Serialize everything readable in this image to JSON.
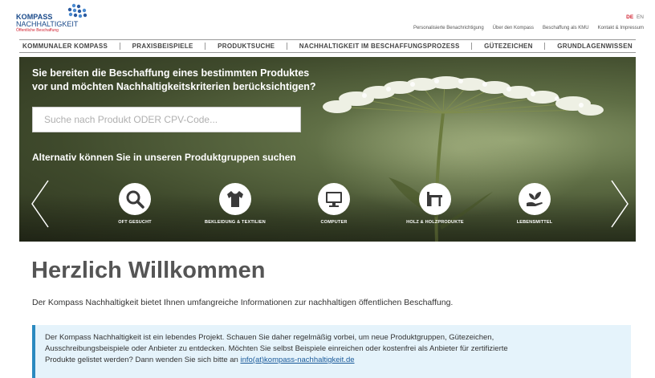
{
  "logo": {
    "line1": "KOMPASS",
    "line2": "NACHHALTIGKEIT",
    "line3": "Öffentliche Beschaffung"
  },
  "lang": {
    "de": "DE",
    "en": "EN"
  },
  "topnav": [
    "Personalisierte Benachrichtigung",
    "Über den Kompass",
    "Beschaffung als KMU",
    "Kontakt & Impressum"
  ],
  "mainnav": [
    "KOMMUNALER KOMPASS",
    "PRAXISBEISPIELE",
    "PRODUKTSUCHE",
    "NACHHALTIGKEIT IM BESCHAFFUNGSPROZESS",
    "GÜTEZEICHEN",
    "GRUNDLAGENWISSEN"
  ],
  "hero": {
    "title_line1": "Sie bereiten die Beschaffung eines bestimmten Produktes",
    "title_line2": "vor und möchten Nachhaltigkeitskriterien berücksichtigen?",
    "search_placeholder": "Suche nach Produkt ODER CPV-Code...",
    "search_value": "",
    "subtitle": "Alternativ können Sie in unseren Produktgruppen suchen",
    "categories": [
      {
        "label": "OFT GESUCHT",
        "icon": "magnifier-icon"
      },
      {
        "label": "BEKLEIDUNG & TEXTILIEN",
        "icon": "shirt-icon"
      },
      {
        "label": "COMPUTER",
        "icon": "monitor-icon"
      },
      {
        "label": "HOLZ & HOLZPRODUKTE",
        "icon": "table-icon"
      },
      {
        "label": "LEBENSMITTEL",
        "icon": "sprout-hand-icon"
      }
    ]
  },
  "welcome": {
    "title": "Herzlich Willkommen",
    "text": "Der Kompass Nachhaltigkeit bietet Ihnen umfangreiche Informationen zur nachhaltigen öffentlichen Beschaffung."
  },
  "info": {
    "line1": "Der Kompass Nachhaltigkeit ist ein lebendes Projekt. Schauen Sie daher regelmäßig vorbei, um neue Produktgruppen, Gütezeichen,",
    "line2": "Ausschreibungsbeispiele oder Anbieter zu entdecken. Möchten Sie selbst Beispiele einreichen oder kostenfrei als Anbieter für zertifizierte",
    "line3_prefix": "Produkte gelistet werden? Dann wenden Sie sich bitte an ",
    "email": "info(at)kompass-nachhaltigkeit.de"
  },
  "colors": {
    "brand_blue": "#1a4a8a",
    "brand_red": "#d01e2e",
    "info_bg": "#e5f3fb",
    "info_border": "#2a8ac0"
  }
}
